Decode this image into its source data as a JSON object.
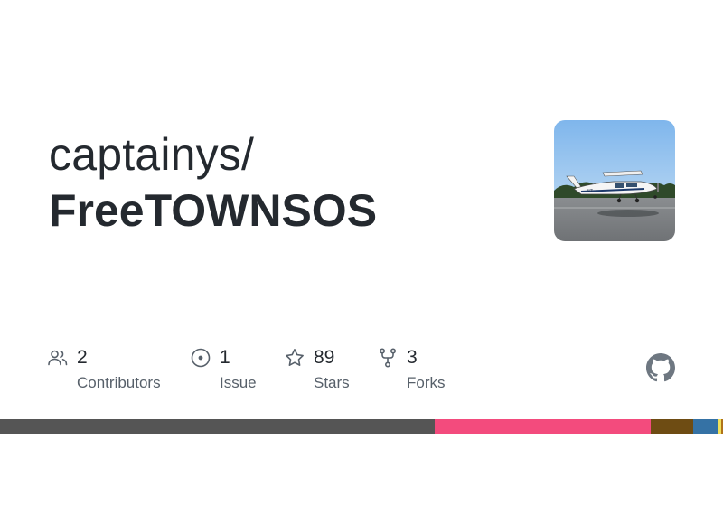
{
  "repo": {
    "owner": "captainys/",
    "name": "FreeTOWNSOS"
  },
  "avatar": {
    "icon": "airplane-photo",
    "description_colors": {
      "sky": "#8fc0ee",
      "ground": "#7c7f82",
      "trees": "#2f4a2a"
    }
  },
  "stats": [
    {
      "icon": "people-icon",
      "value": "2",
      "label": "Contributors"
    },
    {
      "icon": "issue-icon",
      "value": "1",
      "label": "Issue"
    },
    {
      "icon": "star-icon",
      "value": "89",
      "label": "Stars"
    },
    {
      "icon": "fork-icon",
      "value": "3",
      "label": "Forks"
    }
  ],
  "github_logo": {
    "icon": "github-mark-icon",
    "color": "#6e7781"
  },
  "language_bar": [
    {
      "color": "#555555",
      "percent": 60.1
    },
    {
      "color": "#f34b7d",
      "percent": 29.9
    },
    {
      "color": "#6e4c13",
      "percent": 5.9
    },
    {
      "color": "#3572a5",
      "percent": 3.5
    },
    {
      "color": "#f1e05a",
      "percent": 0.4
    },
    {
      "color": "#b07219",
      "percent": 0.2
    }
  ],
  "colors": {
    "text_primary": "#24292f",
    "text_secondary": "#57606a",
    "icon": "#57606a"
  }
}
